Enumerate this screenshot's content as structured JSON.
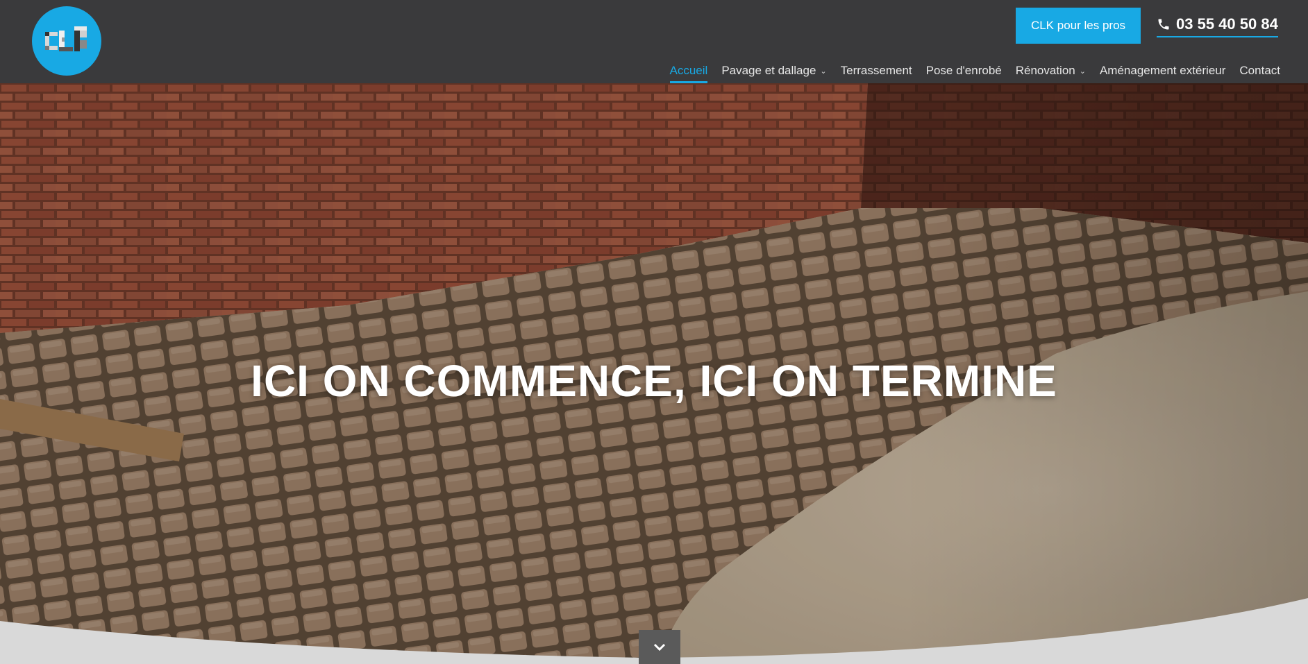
{
  "brand": {
    "logo_text": "CLK",
    "accent": "#18a9e4"
  },
  "topbar": {
    "pro_button_label": "CLK pour les pros",
    "phone_number": "03 55 40 50 84",
    "phone_icon": "phone-icon"
  },
  "nav": {
    "items": [
      {
        "label": "Accueil",
        "active": true,
        "dropdown": false
      },
      {
        "label": "Pavage et dallage",
        "active": false,
        "dropdown": true
      },
      {
        "label": "Terrassement",
        "active": false,
        "dropdown": false
      },
      {
        "label": "Pose d'enrobé",
        "active": false,
        "dropdown": false
      },
      {
        "label": "Rénovation",
        "active": false,
        "dropdown": true
      },
      {
        "label": "Aménagement extérieur",
        "active": false,
        "dropdown": false
      },
      {
        "label": "Contact",
        "active": false,
        "dropdown": false
      }
    ],
    "dropdown_icon": "chevron-down-icon"
  },
  "hero": {
    "title": "ICI ON COMMENCE, ICI ON TERMINE",
    "scroll_icon": "chevron-down-icon"
  }
}
